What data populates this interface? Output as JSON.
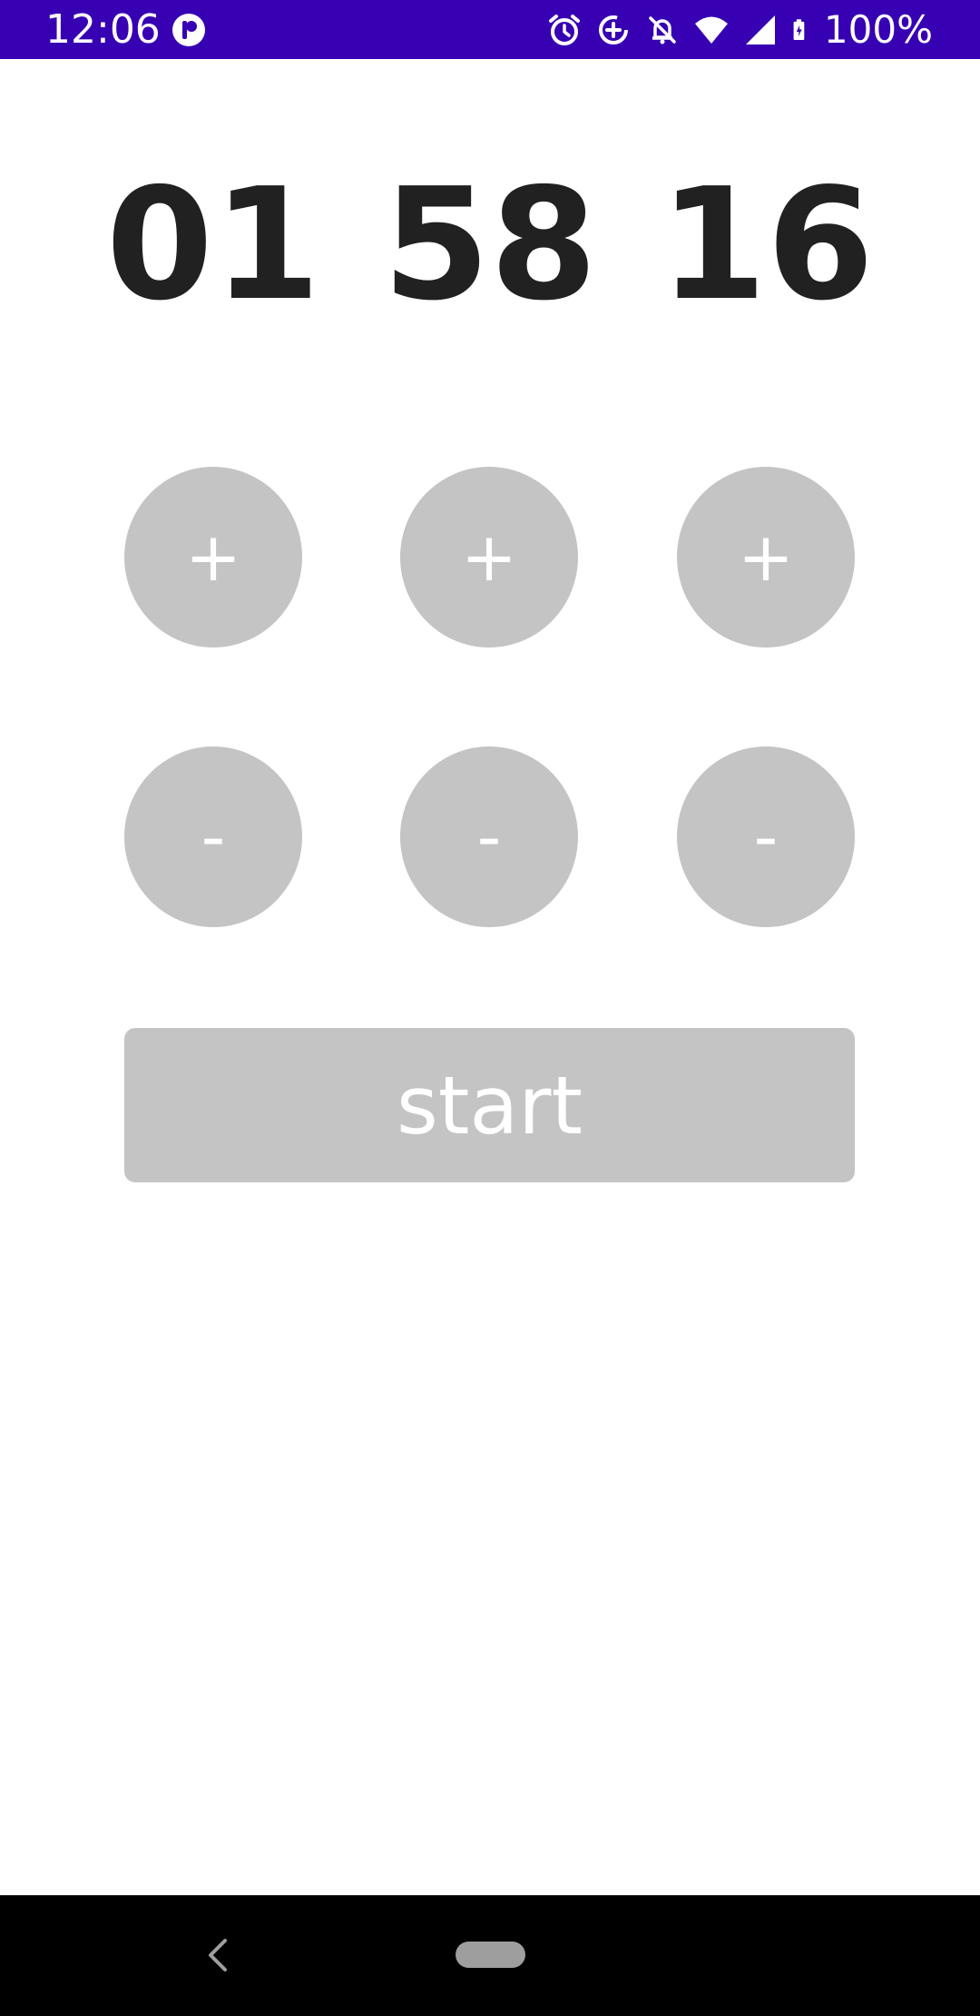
{
  "status_bar": {
    "time": "12:06",
    "battery_percent": "100%",
    "background_color": "#3700b3",
    "icons": [
      "app-notification-icon",
      "alarm-icon",
      "data-saver-icon",
      "notifications-off-icon",
      "wifi-icon",
      "signal-icon",
      "battery-charging-icon"
    ]
  },
  "timer": {
    "hours": "01",
    "minutes": "58",
    "seconds": "16"
  },
  "controls": {
    "increment_label": "+",
    "decrement_label": "-",
    "start_label": "start",
    "button_color": "#c4c4c4"
  },
  "nav_bar": {
    "icons": [
      "back-icon",
      "home-pill-icon"
    ]
  }
}
